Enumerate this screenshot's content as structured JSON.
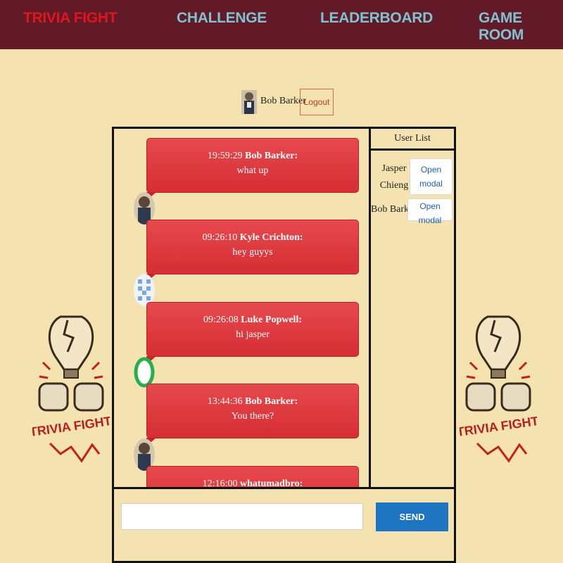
{
  "nav": {
    "brand": "TRIVIA FIGHT",
    "links": [
      "CHALLENGE",
      "LEADERBOARD",
      "GAME ROOM"
    ]
  },
  "user": {
    "name": "Bob Barker",
    "logout_label": "Logout"
  },
  "messages": [
    {
      "time": "19:59:29",
      "author": "Bob Barker:",
      "text": "what up"
    },
    {
      "time": "09:26:10",
      "author": "Kyle Crichton:",
      "text": "hey guyys"
    },
    {
      "time": "09:26:08",
      "author": "Luke Popwell:",
      "text": "hi jasper"
    },
    {
      "time": "13:44:36",
      "author": "Bob Barker:",
      "text": "You there?"
    },
    {
      "time": "12:16:00",
      "author": "whatumadbro:",
      "text": ""
    }
  ],
  "user_list": {
    "title": "User List",
    "users": [
      {
        "name": "Jasper Chieng",
        "button": "Open modal"
      },
      {
        "name": "Bob Barker",
        "button": "Open modal"
      }
    ]
  },
  "composer": {
    "value": "",
    "placeholder": "",
    "send_label": "SEND"
  },
  "logo_text": "TRIVIA FIGHT",
  "colors": {
    "background": "#f4e2b0",
    "nav_bg": "#621a28",
    "brand": "#e0161e",
    "nav_link": "#7fc2d0",
    "bubble": "#e0393e",
    "send": "#1d74c0"
  }
}
